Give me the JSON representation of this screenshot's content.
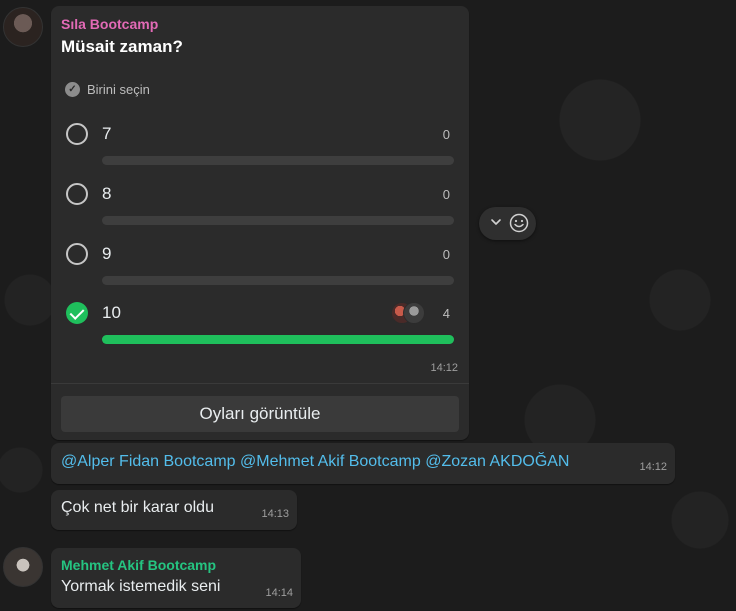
{
  "poll_message": {
    "sender": "Sıla Bootcamp",
    "question": "Müsait zaman?",
    "select_hint": "Birini seçin",
    "options": [
      {
        "label": "7",
        "count": "0",
        "selected": false,
        "fraction": 0
      },
      {
        "label": "8",
        "count": "0",
        "selected": false,
        "fraction": 0
      },
      {
        "label": "9",
        "count": "0",
        "selected": false,
        "fraction": 0
      },
      {
        "label": "10",
        "count": "4",
        "selected": true,
        "fraction": 1
      }
    ],
    "time": "14:12",
    "view_votes_label": "Oyları görüntüle"
  },
  "mention_message": {
    "text": "@Alper Fidan Bootcamp @Mehmet Akif Bootcamp @Zozan AKDOĞAN",
    "time": "14:12"
  },
  "decision_message": {
    "text": "Çok net bir karar oldu",
    "time": "14:13"
  },
  "reply_message": {
    "sender": "Mehmet Akif Bootcamp",
    "text": "Yormak istemedik seni",
    "time": "14:14"
  },
  "colors": {
    "accent_green": "#1fbf5c",
    "sender_pink": "#e26ab6",
    "sender_green": "#25c481",
    "mention_blue": "#53bdeb",
    "bubble_bg": "#2b2b2b"
  },
  "icons": [
    "chevron-down-icon",
    "emoji-smile-icon",
    "check-circle-icon"
  ]
}
